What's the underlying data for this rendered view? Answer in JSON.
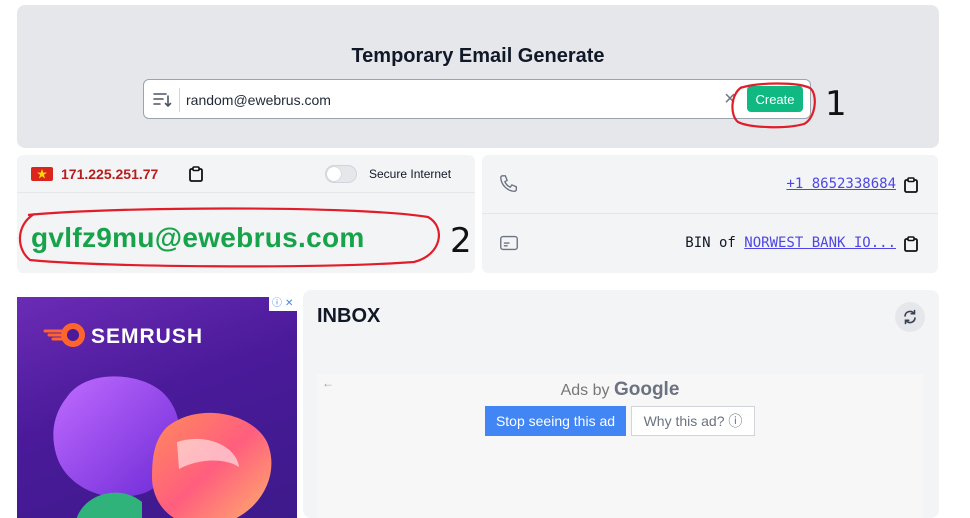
{
  "generator": {
    "title": "Temporary Email Generate",
    "input_value": "random@ewebrus.com",
    "create_label": "Create"
  },
  "session": {
    "ip": "171.225.251.77",
    "secure_label": "Secure Internet",
    "secure_enabled": false,
    "email": "gvlfz9mu@ewebrus.com"
  },
  "info": {
    "phone": "+1 8652338684",
    "bin_prefix": "BIN of",
    "bin_bank": "NORWEST BANK IO..."
  },
  "annotations": {
    "mark_1": "1",
    "mark_2": "2"
  },
  "ad": {
    "brand": "SEMRUSH",
    "badge_info": "ⓘ",
    "badge_close": "✕"
  },
  "inbox": {
    "title": "INBOX",
    "ads_by": "Ads by",
    "ads_brand": "Google",
    "back_arrow": "←",
    "stop_label": "Stop seeing this ad",
    "why_label": "Why this ad? ⓘ"
  },
  "colors": {
    "accent_green": "#10b981",
    "email_green": "#16a34a",
    "ip_red": "#b91c1c",
    "link_blue": "#4f46e5",
    "annotation_red": "#e11d2a"
  }
}
